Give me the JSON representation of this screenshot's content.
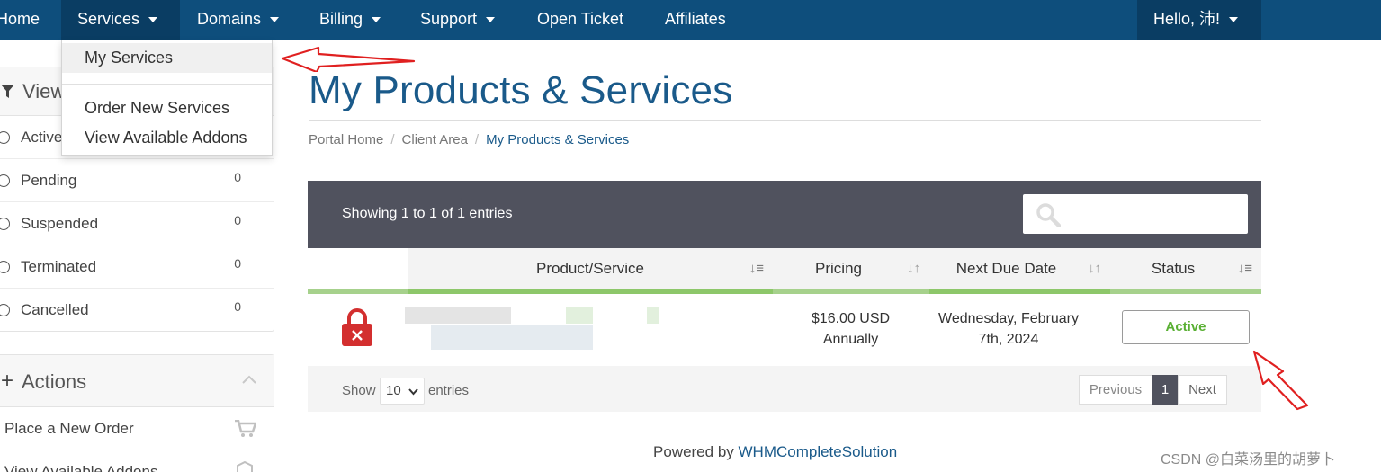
{
  "nav": {
    "items": [
      {
        "label": "Home",
        "caret": false
      },
      {
        "label": "Services",
        "caret": true
      },
      {
        "label": "Domains",
        "caret": true
      },
      {
        "label": "Billing",
        "caret": true
      },
      {
        "label": "Support",
        "caret": true
      },
      {
        "label": "Open Ticket",
        "caret": false
      },
      {
        "label": "Affiliates",
        "caret": false
      }
    ],
    "user": "Hello, 沛!"
  },
  "dropdown": {
    "items": [
      "My Services",
      "Order New Services",
      "View Available Addons"
    ]
  },
  "sidebar": {
    "view_title": "View",
    "filters": [
      {
        "label": "Active",
        "count": ""
      },
      {
        "label": "Pending",
        "count": "0"
      },
      {
        "label": "Suspended",
        "count": "0"
      },
      {
        "label": "Terminated",
        "count": "0"
      },
      {
        "label": "Cancelled",
        "count": "0"
      }
    ],
    "actions_title": "Actions",
    "actions": [
      "Place a New Order",
      "View Available Addons"
    ]
  },
  "main": {
    "title": "My Products & Services",
    "breadcrumb": [
      "Portal Home",
      "Client Area",
      "My Products & Services"
    ]
  },
  "table": {
    "showing": "Showing 1 to 1 of 1 entries",
    "columns": [
      "Product/Service",
      "Pricing",
      "Next Due Date",
      "Status"
    ],
    "rows": [
      {
        "pricing_amount": "$16.00 USD",
        "pricing_cycle": "Annually",
        "due_line1": "Wednesday, February",
        "due_line2": "7th, 2024",
        "status": "Active"
      }
    ],
    "show_label": "Show",
    "page_size": "10",
    "entries_label": "entries",
    "pager": {
      "prev": "Previous",
      "current": "1",
      "next": "Next"
    }
  },
  "footer": {
    "prefix": "Powered by ",
    "link": "WHMCompleteSolution"
  },
  "watermark": "CSDN @白菜汤里的胡萝卜",
  "colors": {
    "nav": "#0e4e7c",
    "accent": "#1a5a8a",
    "table_header": "#50525e",
    "green": "#8dc76a",
    "active": "#5ab034",
    "lock_red": "#d32f2f",
    "annotation_arrow": "#e02020"
  }
}
